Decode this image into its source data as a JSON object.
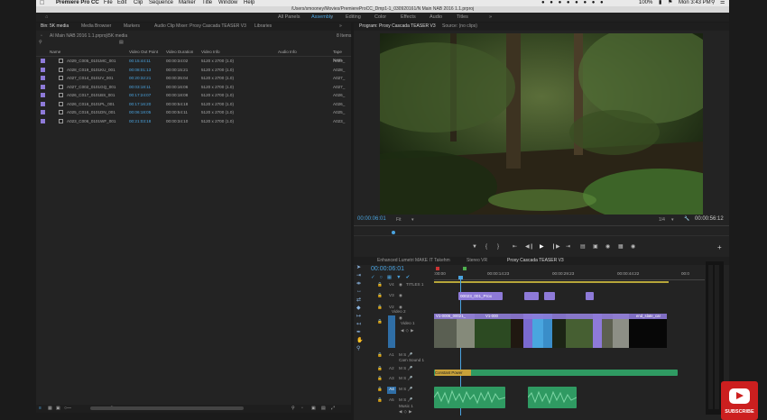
{
  "menubar": {
    "app_name": "Premiere Pro CC",
    "items": [
      "File",
      "Edit",
      "Clip",
      "Sequence",
      "Marker",
      "Title",
      "Window",
      "Help"
    ],
    "battery": "100%",
    "clock": "Mon 3:43 PM"
  },
  "path_bar": {
    "text": "/Users/smooney/Movies/PremiereProCC_Dmp1-1_030920161/N Main NAB 2016 1.1.prproj"
  },
  "workspaces": {
    "items": [
      "All Panels",
      "Assembly",
      "Editing",
      "Color",
      "Effects",
      "Audio",
      "Titles"
    ],
    "active": "Assembly"
  },
  "project": {
    "tabs": [
      "Bin: 5K media",
      "Media Browser",
      "Markers",
      "Audio Clip Mixer: Proxy Cascada TEASER V3",
      "Libraries"
    ],
    "bin_path": "AI Main NAB 2016 1.1.prproj\\5K media",
    "item_count": "8 Items",
    "columns": [
      "Name",
      "Video Out Point",
      "Video Duration",
      "Video Info",
      "Audio Info",
      "Tape Nam"
    ],
    "rows": [
      {
        "name": "A029_C005_0101MC_001",
        "out": "00:15:44:11",
        "dur": "00:00:34:02",
        "info": "5120 x 2700 (1.0)",
        "tape": "A029_"
      },
      {
        "name": "A028_C019_0101KU_001",
        "out": "00:08:01:13",
        "dur": "00:00:15:21",
        "info": "5120 x 2700 (1.0)",
        "tape": "A028_"
      },
      {
        "name": "A027_C014_0101IV_001",
        "out": "00:20:32:21",
        "dur": "00:00:35:04",
        "info": "5120 x 2700 (1.0)",
        "tape": "A027_"
      },
      {
        "name": "A027_C002_0101GQ_001",
        "out": "00:03:18:11",
        "dur": "00:00:16:06",
        "info": "5120 x 2700 (1.0)",
        "tape": "A027_"
      },
      {
        "name": "A026_C017_0101BS_001",
        "out": "00:17:24:07",
        "dur": "00:00:18:08",
        "info": "5120 x 2700 (1.0)",
        "tape": "A026_"
      },
      {
        "name": "A026_C016_0101PL_001",
        "out": "00:17:16:20",
        "dur": "00:00:54:18",
        "info": "5120 x 2700 (1.0)",
        "tape": "A026_"
      },
      {
        "name": "A025_C016_0101DN_001",
        "out": "00:06:18:05",
        "dur": "00:00:54:11",
        "info": "5120 x 2700 (1.0)",
        "tape": "A025_"
      },
      {
        "name": "A023_C006_0101WF_001",
        "out": "00:21:03:18",
        "dur": "00:00:34:10",
        "info": "5120 x 2700 (1.0)",
        "tape": "A023_"
      }
    ]
  },
  "program": {
    "tab": "Program: Proxy Cascada TEASER V3",
    "source_tab": "Source: (no clips)",
    "timecode": "00:00:06:01",
    "fit": "Fit",
    "resolution": "1/4",
    "duration": "00:00:56:12"
  },
  "timeline": {
    "tabs": [
      "Enhanced Lumetri MAKE IT Takehm",
      "Stereo VR",
      "Proxy Cascada TEASER V3"
    ],
    "timecode": "00:00:06:01",
    "ruler": [
      ":00:00",
      "00:00:14:23",
      "00:00:29:23",
      "00:00:44:22",
      "00:0"
    ],
    "tracks": [
      {
        "id": "V4",
        "name": "TITLES 1"
      },
      {
        "id": "V3",
        "name": ""
      },
      {
        "id": "V2",
        "name": "Video 2"
      },
      {
        "id": "V1",
        "name": "Video 1"
      },
      {
        "id": "A1",
        "name": "Cam Sound 1"
      },
      {
        "id": "A2",
        "name": ""
      },
      {
        "id": "A3",
        "name": ""
      },
      {
        "id": "A4",
        "name": ""
      },
      {
        "id": "A5",
        "name": "Music 1"
      }
    ],
    "v3_clip": "00023_001_Prox",
    "v1_clips": [
      "V1-0006_00021_",
      "V1-000",
      "end_slate_car"
    ],
    "a3_clip": "Constant Power"
  },
  "youtube": {
    "label": "SUBSCRIBE"
  },
  "colors": {
    "accent": "#4aa3df",
    "clip_violet": "#8e7ad8",
    "audio_green": "#2f9a62"
  }
}
